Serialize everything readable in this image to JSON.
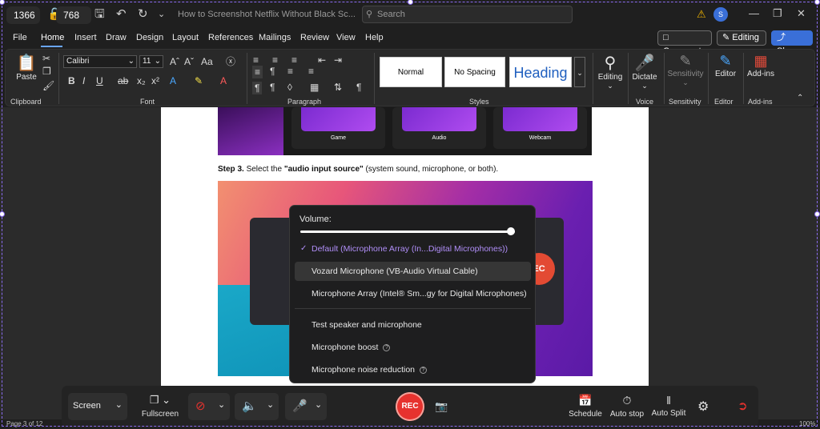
{
  "capture": {
    "width": "1366",
    "height": "768"
  },
  "titlebar": {
    "doc_title": "How to Screenshot Netflix Without Black Sc...",
    "search_placeholder": "Search",
    "avatar": "S"
  },
  "menu": {
    "items": [
      "File",
      "Home",
      "Insert",
      "Draw",
      "Design",
      "Layout",
      "References",
      "Mailings",
      "Review",
      "View",
      "Help"
    ],
    "comments": "Comments",
    "editing": "Editing",
    "share": "Share"
  },
  "ribbon": {
    "paste": "Paste",
    "font_name": "Calibri",
    "font_size": "11",
    "styles": [
      "Normal",
      "No Spacing",
      "Heading"
    ],
    "editing": "Editing",
    "dictate": "Dictate",
    "sensitivity": "Sensitivity",
    "editor": "Editor",
    "addins": "Add-ins",
    "groups": [
      "Clipboard",
      "Font",
      "Paragraph",
      "Styles",
      "Voice",
      "Sensitivity",
      "Editor",
      "Add-ins"
    ]
  },
  "document": {
    "cards": [
      "Game",
      "Audio",
      "Webcam"
    ],
    "step3_bold": "Step 3.",
    "step3_text": " Select the ",
    "step3_quote": "\"audio input source\"",
    "step3_tail": " (system sound, microphone, or both).",
    "rec_ghost": "EC"
  },
  "volume_popup": {
    "label": "Volume:",
    "volume_level": 0.98,
    "options": [
      {
        "label": "Default (Microphone Array (In...Digital Microphones))",
        "selected": true
      },
      {
        "label": "Vozard Microphone (VB-Audio Virtual Cable)",
        "hover": true
      },
      {
        "label": "Microphone Array (Intel® Sm...gy for Digital Microphones)"
      }
    ],
    "extras": [
      "Test speaker and microphone",
      "Microphone boost",
      "Microphone noise reduction"
    ]
  },
  "recbar": {
    "screen": "Screen",
    "fullscreen": "Fullscreen",
    "rec": "REC",
    "schedule": "Schedule",
    "auto_stop": "Auto stop",
    "auto_split": "Auto Split"
  },
  "status": {
    "page": "Page 3 of 12",
    "zoom": "100%"
  },
  "colors": {
    "accent": "#8a6cf0",
    "rec": "#e6322e",
    "share": "#3a6fd8"
  }
}
